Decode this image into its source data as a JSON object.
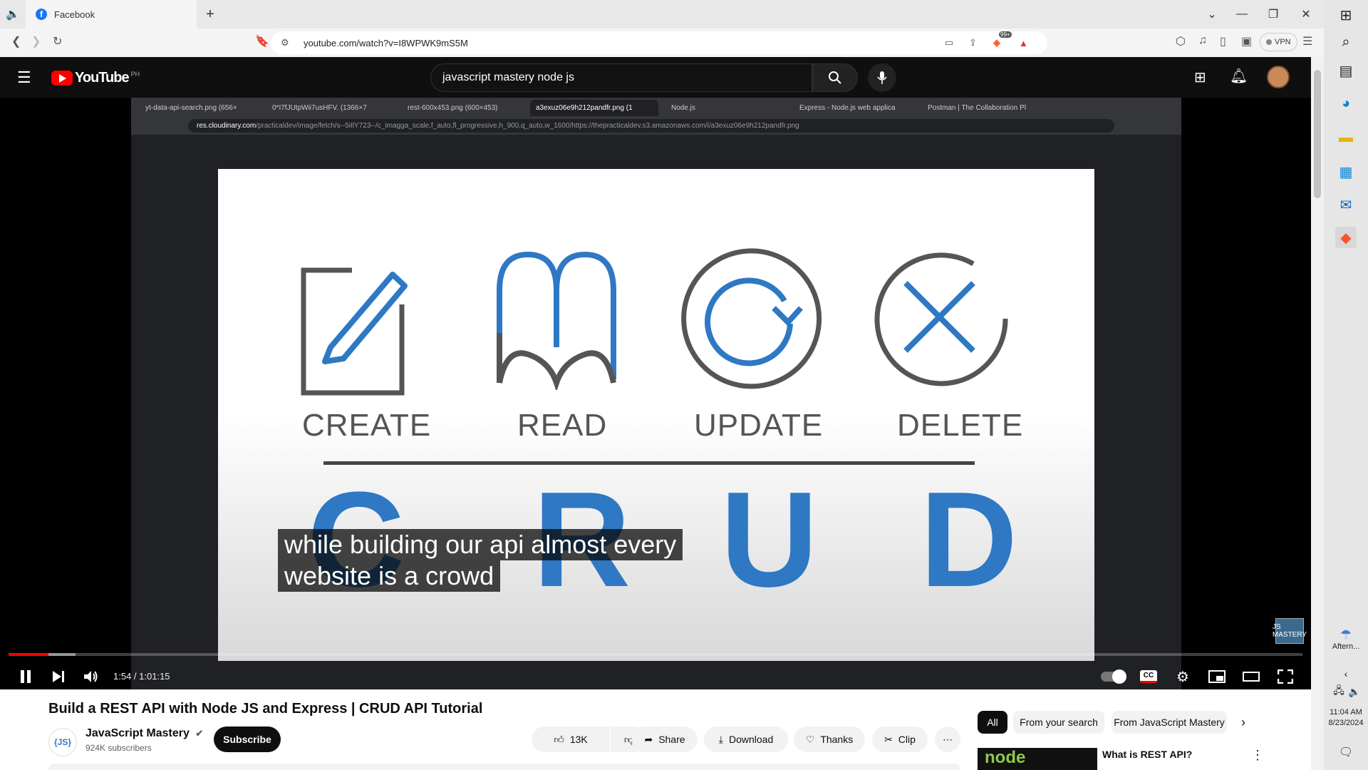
{
  "browser": {
    "tab_title": "Facebook",
    "tab_favicon": "f",
    "new_tab": "+",
    "url": "youtube.com/watch?v=I8WPWK9mS5M",
    "vpn_label": "VPN",
    "brave_badge": "99+"
  },
  "youtube": {
    "logo_text": "YouTube",
    "country_code": "PH",
    "search_query": "javascript mastery node js"
  },
  "video_frame": {
    "inner_tabs": [
      "yt-data-api-search.png (656×",
      "0*I7fJUtpWii7usHFV. (1366×7",
      "rest-600x453.png (600×453)",
      "a3exuz06e9h212pandfr.png (1",
      "Node.js",
      "Express - Node.js web applica",
      "Postman | The Collaboration Pl"
    ],
    "inner_url_host": "res.cloudinary.com",
    "inner_url_path": "/practicaldev/image/fetch/s--5iIlY723--/c_imagga_scale,f_auto,fl_progressive,h_900,q_auto,w_1600/https://thepracticaldev.s3.amazonaws.com/i/a3exuz06e9h212pandfr.png",
    "slide_words": [
      "CREATE",
      "READ",
      "UPDATE",
      "DELETE"
    ],
    "slide_letters": [
      "C",
      "R",
      "U",
      "D"
    ],
    "caption_line1": "while building our api almost every",
    "caption_line2": "website is a crowd",
    "watermark": "JS MASTERY"
  },
  "player": {
    "time_current": "1:54",
    "time_separator": " / ",
    "time_total": "1:01:15",
    "progress_fraction": 0.031,
    "buffer_fraction": 0.052
  },
  "video": {
    "title": "Build a REST API with Node JS and Express | CRUD API Tutorial",
    "channel_name": "JavaScript Mastery",
    "channel_logo": "{JS}",
    "subscribers": "924K subscribers",
    "subscribe_label": "Subscribe",
    "likes": "13K",
    "share_label": "Share",
    "download_label": "Download",
    "thanks_label": "Thanks",
    "clip_label": "Clip"
  },
  "sidebar_chips": [
    "All",
    "From your search",
    "From JavaScript Mastery"
  ],
  "recommendation": {
    "thumb_text": "node",
    "title": "What is REST API?"
  },
  "taskbar": {
    "weather_label": "Aftern...",
    "time": "11:04 AM",
    "date": "8/23/2024"
  },
  "colors": {
    "youtube_red": "#ff0000",
    "crud_blue": "#2e78c4",
    "crud_gray": "#555555"
  }
}
